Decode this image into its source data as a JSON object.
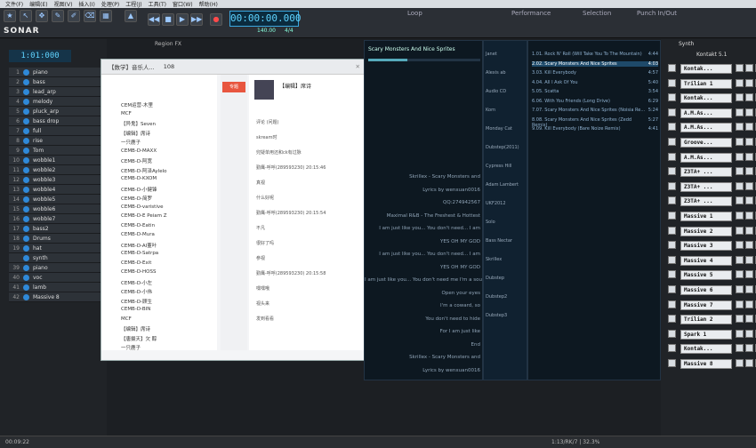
{
  "menu": [
    "文件(F)",
    "编辑(E)",
    "视图(V)",
    "插入(I)",
    "处理(P)",
    "工程(J)",
    "工具(T)",
    "窗口(W)",
    "帮助(H)"
  ],
  "app": {
    "brand": "SONAR",
    "clock": "1:01:000",
    "time": "00:00:00.000",
    "tempo": "140.00",
    "meter": "4/4",
    "loop_label": "Loop",
    "perf_label": "Performance",
    "sel_label": "Selection",
    "punch_label": "Punch In/Out",
    "region_fx": "Region FX",
    "synth_label": "Synth",
    "synth_name": "Kontakt 5.1"
  },
  "tracks": [
    {
      "n": "1",
      "name": "piano"
    },
    {
      "n": "2",
      "name": "bass"
    },
    {
      "n": "3",
      "name": "lead_arp"
    },
    {
      "n": "4",
      "name": "melody"
    },
    {
      "n": "5",
      "name": "pluck_arp"
    },
    {
      "n": "6",
      "name": "bass drop"
    },
    {
      "n": "7",
      "name": "full"
    },
    {
      "n": "8",
      "name": "rise"
    },
    {
      "n": "9",
      "name": "Tom"
    },
    {
      "n": "10",
      "name": "wobble1"
    },
    {
      "n": "11",
      "name": "wobble2"
    },
    {
      "n": "12",
      "name": "wobble3"
    },
    {
      "n": "13",
      "name": "wobble4"
    },
    {
      "n": "14",
      "name": "wobble5"
    },
    {
      "n": "15",
      "name": "wobble6"
    },
    {
      "n": "16",
      "name": "wobble7"
    },
    {
      "n": "17",
      "name": "bass2"
    },
    {
      "n": "18",
      "name": "Drums"
    },
    {
      "n": "19",
      "name": "hat"
    },
    {
      "n": "",
      "name": "synth"
    },
    {
      "n": "39",
      "name": "piano"
    },
    {
      "n": "40",
      "name": "voc"
    },
    {
      "n": "41",
      "name": "lamb"
    },
    {
      "n": "42",
      "name": "Massive 8"
    }
  ],
  "qq": {
    "title": "【数学】音乐人...",
    "count": "108",
    "tab": "专题",
    "members": [
      "CEM运营-木里",
      "MCF",
      "【异鬼】Seven",
      "【编辑】席诗",
      "一只鹿子",
      "CEMB-D-MAXX",
      "CEMB-D-阿宽",
      "CEMB-D-阿泽Aylelo",
      "CEMB-D-KXOM",
      "CEMB-D-小健锋",
      "CEMB-D-简罗",
      "CEMB-D-varistive",
      "CEMB-D-E Peiam Z",
      "CEMB-D-Eatin",
      "CEMB-D-Mura",
      "CEMB-D-AI董叶",
      "CEMB-D-Satrpa",
      "CEMB-D-Exit",
      "CEMB-D-HOSS",
      "CEMB-D-小左",
      "CEMB-D-小伟",
      "CEMB-D-顾生",
      "CEMB-D-BIN",
      "MCF",
      "【编辑】席诗",
      "【唐摄天】欠 醇",
      "一只鹿子"
    ],
    "group_name": "【编辑】席诗",
    "chat": [
      "评论 (问题)",
      "skream时",
      "兜疑单用还和ck有过脉",
      "勤鹰-呼呼(289593230) 20:15:46",
      "真视",
      "什么好呢",
      "勤鹰-呼呼(289593230) 20:15:54",
      "不凡",
      "很好了吗",
      "参视",
      "勤鹰-呼呼(289593230) 20:15:58",
      "嘿嘿哦",
      "视头来",
      "发到看看"
    ]
  },
  "lyrics": [
    "Skrillex - Scary Monsters and",
    "Lyrics by wenxuan0016",
    "QQ:274942567",
    "Maximal R&B - The Freshest & Hottest",
    "I am just like you... You don't need... I am",
    "YES OH MY GOD",
    "I am just like you... You don't need... I am",
    "YES OH MY GOD",
    "I am just like you... You don't need me I'm a sou",
    "Open your eyes",
    "I'm a coward, so",
    "You don't need to hide",
    "For I am just like",
    "End",
    "Skrillex - Scary Monsters and",
    "Lyrics by wenxuan0016"
  ],
  "now_playing": "Scary Monsters And Nice Sprites",
  "playlists": [
    "Janet",
    "Alexis ab",
    "Audio CD",
    "Korn",
    "Monday Cat",
    "Dubstep(2011)",
    "Cypress Hill",
    "Adam Lambert",
    "UKF2012",
    "Solo",
    "Bass Nectar",
    "Skrillex",
    "Dubstep",
    "Dubstep2",
    "Dubstep3"
  ],
  "songs": [
    {
      "t": "1.01. Rock N' Roll (Will Take You To The Mountain)",
      "d": "4:44"
    },
    {
      "t": "2.02. Scary Monsters And Nice Sprites",
      "d": "4:03"
    },
    {
      "t": "3.03. Kill Everybody",
      "d": "4:57"
    },
    {
      "t": "4.04. All I Ask Of You",
      "d": "5:40"
    },
    {
      "t": "5.05. Scatta",
      "d": "3:54"
    },
    {
      "t": "6.06. With You Friends (Long Drive)",
      "d": "6:29"
    },
    {
      "t": "7.07. Scary Monsters And Nice Sprites (Noisia Re...",
      "d": "5:24"
    },
    {
      "t": "8.08. Scary Monsters And Nice Sprites (Zedd Remix)",
      "d": "5:27"
    },
    {
      "t": "9.09. Kill Everybody (Bare Noize Remix)",
      "d": "4:41"
    }
  ],
  "instruments": [
    "Kontak...",
    "Trilian 1",
    "Kontak...",
    "A.M.As...",
    "A.M.As...",
    "Groove...",
    "A.M.As...",
    "Z3TA+ ...",
    "Z3TA+ ...",
    "Z3TA+ ...",
    "Massive 1",
    "Massive 2",
    "Massive 3",
    "Massive 4",
    "Massive 5",
    "Massive 6",
    "Massive 7",
    "Trilian 2",
    "Spark 1",
    "Kontak...",
    "Massive 8"
  ],
  "status": {
    "left": "00:09:22",
    "right": "1:13/RK/7 | 32.3%"
  }
}
